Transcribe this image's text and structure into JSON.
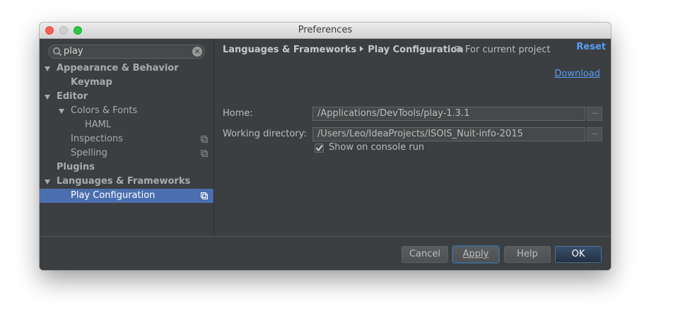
{
  "window": {
    "title": "Preferences"
  },
  "sidebar": {
    "search": {
      "value": "play"
    },
    "items": [
      {
        "label": "Appearance & Behavior",
        "indent": 1,
        "arrow": true,
        "bold": true,
        "selected": false,
        "icon": null
      },
      {
        "label": "Keymap",
        "indent": 2,
        "arrow": false,
        "bold": true,
        "selected": false,
        "icon": null
      },
      {
        "label": "Editor",
        "indent": 1,
        "arrow": true,
        "bold": true,
        "selected": false,
        "icon": null
      },
      {
        "label": "Colors & Fonts",
        "indent": 2,
        "arrow": true,
        "bold": false,
        "selected": false,
        "icon": null
      },
      {
        "label": "HAML",
        "indent": 3,
        "arrow": false,
        "bold": false,
        "selected": false,
        "icon": null
      },
      {
        "label": "Inspections",
        "indent": 2,
        "arrow": false,
        "bold": false,
        "selected": false,
        "icon": "project-scope-icon"
      },
      {
        "label": "Spelling",
        "indent": 2,
        "arrow": false,
        "bold": false,
        "selected": false,
        "icon": "project-scope-icon"
      },
      {
        "label": "Plugins",
        "indent": 1,
        "arrow": false,
        "bold": true,
        "selected": false,
        "icon": null
      },
      {
        "label": "Languages & Frameworks",
        "indent": 1,
        "arrow": true,
        "bold": true,
        "selected": false,
        "icon": null
      },
      {
        "label": "Play Configuration",
        "indent": 2,
        "arrow": false,
        "bold": false,
        "selected": true,
        "icon": "project-scope-icon"
      }
    ]
  },
  "content": {
    "breadcrumb": {
      "parent": "Languages & Frameworks",
      "current": "Play Configuration"
    },
    "scope_label": "For current project",
    "reset_label": "Reset",
    "download_label": "Download",
    "home": {
      "label": "Home:",
      "value": "/Applications/DevTools/play-1.3.1",
      "browse_label": "..."
    },
    "working_dir": {
      "label": "Working directory:",
      "value": "/Users/Leo/IdeaProjects/ISOIS_Nuit-info-2015",
      "browse_label": "..."
    },
    "show_console": {
      "label": "Show on console run",
      "checked": true
    }
  },
  "footer": {
    "cancel_label": "Cancel",
    "apply_label": "Apply",
    "help_label": "Help",
    "ok_label": "OK"
  },
  "colors": {
    "panel_bg": "#3c3f41",
    "selection": "#4b6eaf",
    "link": "#589df6",
    "text": "#bbbbbb"
  }
}
